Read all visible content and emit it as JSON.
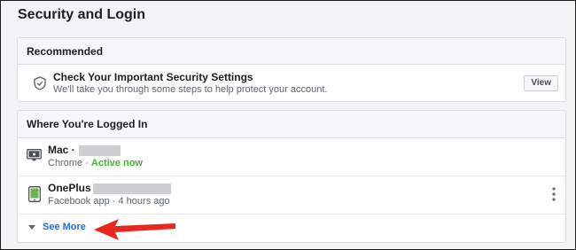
{
  "page": {
    "title": "Security and Login"
  },
  "recommended": {
    "header": "Recommended",
    "item": {
      "icon": "shield-icon",
      "title": "Check Your Important Security Settings",
      "subtitle": "We'll take you through some steps to help protect your account.",
      "button": "View"
    }
  },
  "logged_in": {
    "header": "Where You're Logged In",
    "sessions": [
      {
        "device": "Mac ·",
        "icon": "desktop-mac-icon",
        "browser": "Chrome",
        "separator": " · ",
        "status": "Active now",
        "status_color": "#42b72a"
      },
      {
        "device": "OnePlus",
        "icon": "phone-icon",
        "browser": "Facebook app",
        "separator": " · ",
        "status": "4 hours ago"
      }
    ],
    "see_more": "See More"
  },
  "colors": {
    "link": "#216fdb",
    "annotation_arrow": "#e8271f",
    "active": "#42b72a"
  }
}
